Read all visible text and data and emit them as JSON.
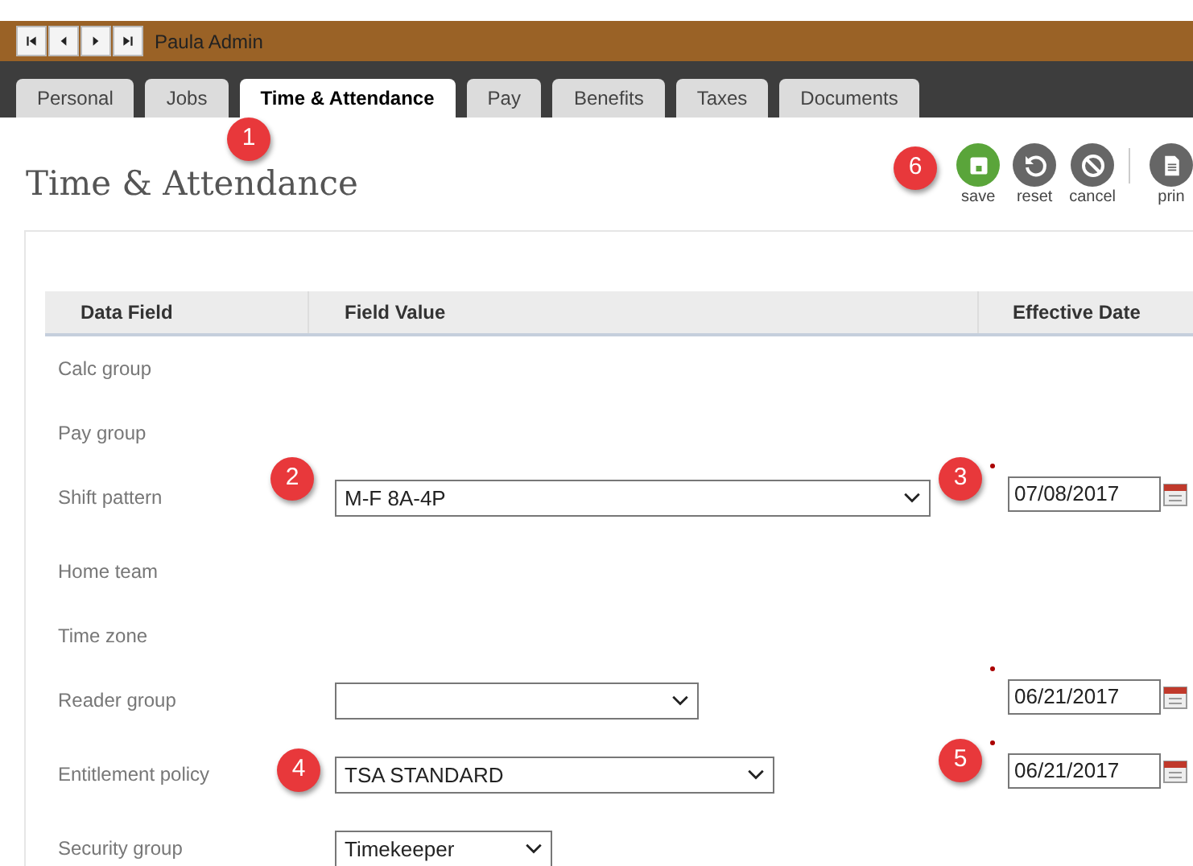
{
  "record_bar": {
    "name": "Paula Admin",
    "nav": [
      {
        "kind": "first"
      },
      {
        "kind": "prev"
      },
      {
        "kind": "next"
      },
      {
        "kind": "last"
      }
    ]
  },
  "tabs": [
    {
      "label": "Personal",
      "selected": false
    },
    {
      "label": "Jobs",
      "selected": false
    },
    {
      "label": "Time & Attendance",
      "selected": true
    },
    {
      "label": "Pay",
      "selected": false
    },
    {
      "label": "Benefits",
      "selected": false
    },
    {
      "label": "Taxes",
      "selected": false
    },
    {
      "label": "Documents",
      "selected": false
    }
  ],
  "page_title": "Time & Attendance",
  "toolbar": [
    {
      "kind": "save",
      "label": "save"
    },
    {
      "kind": "reset",
      "label": "reset"
    },
    {
      "kind": "cancel",
      "label": "cancel"
    },
    {
      "kind": "print",
      "label": "prin"
    }
  ],
  "table": {
    "columns": [
      "Data Field",
      "Field Value",
      "Effective Date"
    ],
    "rows": [
      {
        "label": "Calc group"
      },
      {
        "label": "Pay group"
      },
      {
        "label": "Shift pattern",
        "value": "M-F 8A-4P",
        "date": "07/08/2017",
        "required": true
      },
      {
        "label": "Home team"
      },
      {
        "label": "Time zone"
      },
      {
        "label": "Reader group",
        "value": "",
        "date": "06/21/2017",
        "required": true
      },
      {
        "label": "Entitlement policy",
        "value": "TSA STANDARD",
        "date": "06/21/2017",
        "required": true
      },
      {
        "label": "Security group",
        "value": "Timekeeper"
      }
    ]
  },
  "callouts": [
    "1",
    "2",
    "3",
    "4",
    "5",
    "6"
  ]
}
